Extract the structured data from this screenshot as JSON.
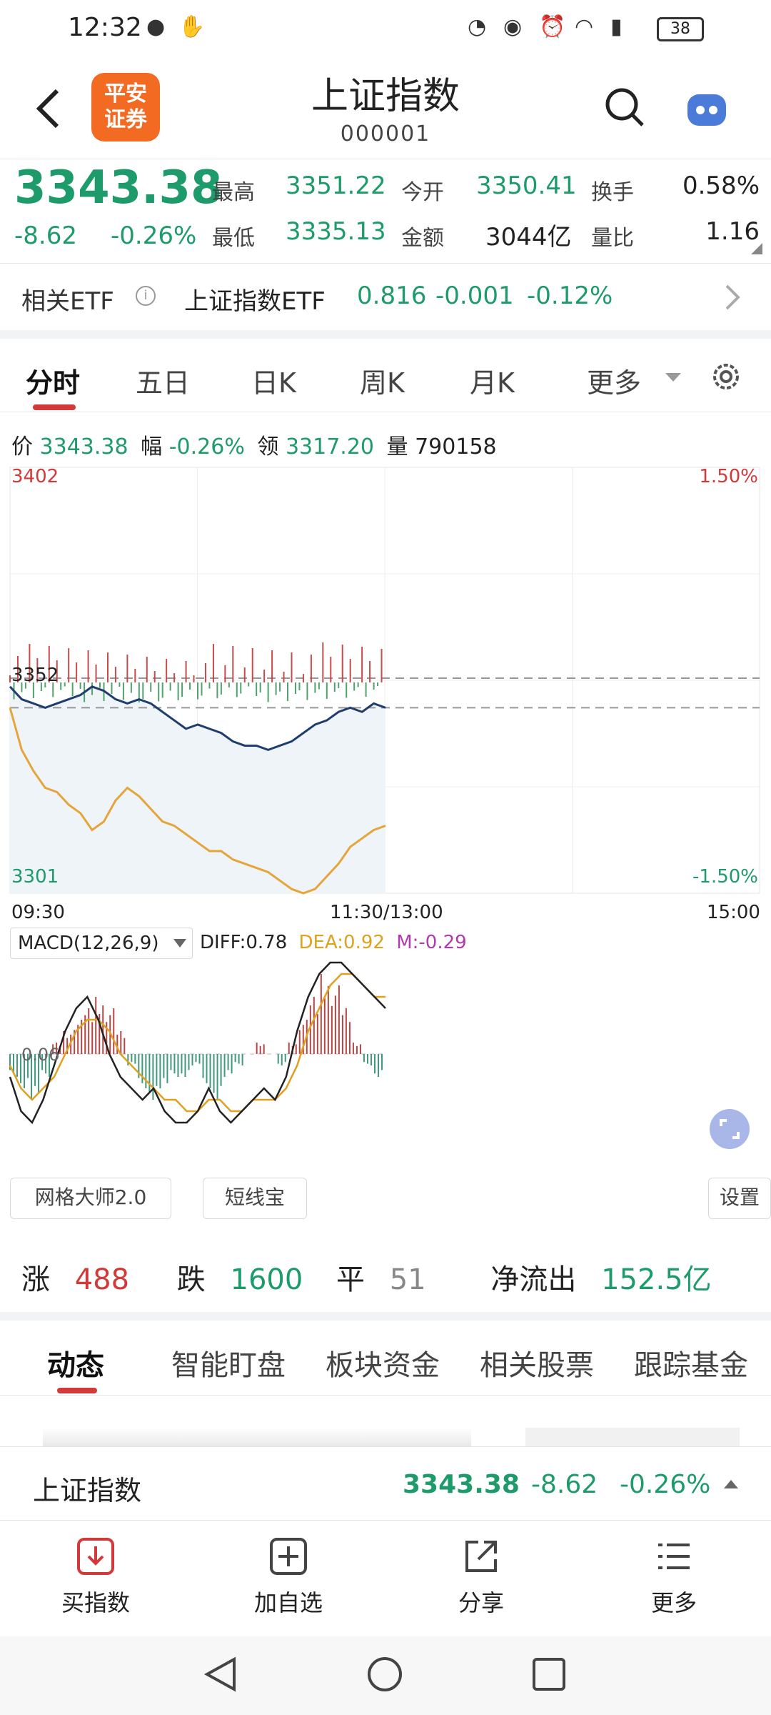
{
  "status": {
    "time": "12:32",
    "battery": "38"
  },
  "header": {
    "back_icon": "back-chevron-icon",
    "logo_line1": "平安",
    "logo_line2": "证券",
    "title": "上证指数",
    "code": "000001",
    "search_icon": "search-icon",
    "assistant_icon": "robot-assistant-icon"
  },
  "quote": {
    "price": "3343.38",
    "change": "-8.62",
    "change_pct": "-0.26%",
    "high_label": "最高",
    "high": "3351.22",
    "low_label": "最低",
    "low": "3335.13",
    "open_label": "今开",
    "open": "3350.41",
    "amount_label": "金额",
    "amount": "3044亿",
    "turnover_label": "换手",
    "turnover": "0.58%",
    "volratio_label": "量比",
    "volratio": "1.16"
  },
  "etf": {
    "label": "相关ETF",
    "name": "上证指数ETF",
    "price": "0.816",
    "change": "-0.001",
    "change_pct": "-0.12%"
  },
  "tabs": [
    "分时",
    "五日",
    "日K",
    "周K",
    "月K",
    "更多"
  ],
  "chart_info": {
    "price_label": "价",
    "price": "3343.38",
    "amp_label": "幅",
    "amp": "-0.26%",
    "lead_label": "领",
    "lead": "3317.20",
    "vol_label": "量",
    "vol": "790158"
  },
  "chart_data": {
    "type": "line",
    "y_top": "3402",
    "y_mid": "3352",
    "y_bottom": "3301",
    "pct_top": "1.50%",
    "pct_bottom": "-1.50%",
    "x_start": "09:30",
    "x_mid": "11:30/13:00",
    "x_end": "15:00",
    "ylim": [
      3301,
      3402
    ],
    "prev_close": 3352,
    "index_series": [
      3350,
      3347,
      3346,
      3345,
      3346,
      3347,
      3348,
      3350,
      3349,
      3347,
      3346,
      3347,
      3346,
      3344,
      3342,
      3340,
      3341,
      3340,
      3339,
      3337,
      3336,
      3336,
      3335,
      3336,
      3337,
      3339,
      3341,
      3342,
      3344,
      3345,
      3344,
      3346,
      3345
    ],
    "lead_series": [
      3345,
      3335,
      3330,
      3326,
      3325,
      3322,
      3320,
      3316,
      3318,
      3323,
      3326,
      3324,
      3321,
      3318,
      3317,
      3315,
      3313,
      3311,
      3311,
      3309,
      3308,
      3307,
      3306,
      3304,
      3302,
      3301,
      3302,
      3305,
      3308,
      3312,
      3314,
      3316,
      3317
    ],
    "macd_title": "MACD(12,26,9)",
    "diff_label": "DIFF:0.78",
    "dea_label": "DEA:0.92",
    "m_label": "M:-0.29",
    "macd_zero_label": "0.06",
    "macd_hist": [
      -2,
      -3,
      -4,
      -2,
      1,
      2,
      3,
      4,
      5,
      4,
      2,
      -1,
      -3,
      -4,
      -3,
      -2,
      -2,
      -1,
      -3,
      -4,
      -2,
      -1,
      0,
      1,
      0,
      -1,
      1,
      3,
      5,
      7,
      6,
      4,
      1,
      -1,
      -2
    ],
    "diff_series": [
      -2,
      -5,
      -6,
      -4,
      -1,
      2,
      4,
      5,
      3,
      0,
      -2,
      -3,
      -4,
      -3,
      -5,
      -6,
      -6,
      -5,
      -3,
      -5,
      -6,
      -5,
      -4,
      -3,
      -4,
      -2,
      2,
      5,
      7,
      8,
      8,
      7,
      6,
      5,
      4
    ],
    "dea_series": [
      -1,
      -3,
      -4,
      -3,
      -2,
      0,
      2,
      3,
      3,
      2,
      0,
      -1,
      -2,
      -3,
      -4,
      -4,
      -5,
      -5,
      -4,
      -4,
      -5,
      -5,
      -4,
      -4,
      -4,
      -3,
      -1,
      2,
      4,
      6,
      7,
      7,
      6,
      5,
      5
    ]
  },
  "tools": {
    "grid_master": "网格大师2.0",
    "short_line": "短线宝",
    "settings": "设置"
  },
  "breadth": {
    "up_label": "涨",
    "up": "488",
    "down_label": "跌",
    "down": "1600",
    "flat_label": "平",
    "flat": "51",
    "flow_label": "净流出",
    "flow": "152.5亿"
  },
  "news_tabs": [
    "动态",
    "智能盯盘",
    "板块资金",
    "相关股票",
    "跟踪基金"
  ],
  "sticky": {
    "name": "上证指数",
    "price": "3343.38",
    "change": "-8.62",
    "change_pct": "-0.26%"
  },
  "bottom_bar": {
    "buy": "买指数",
    "add": "加自选",
    "share": "分享",
    "more": "更多"
  }
}
